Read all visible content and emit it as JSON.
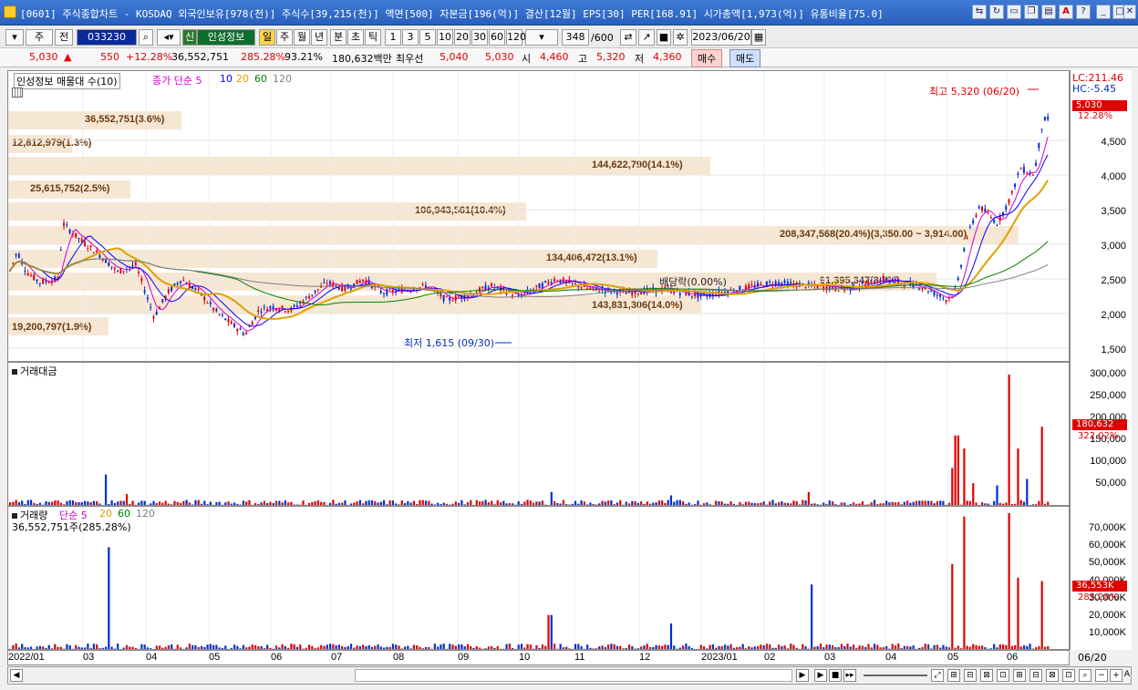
{
  "window": {
    "title": "[0601] 주식종합차트 - KOSDAQ 외국인보유[978(천)] 주식수[39,215(천)] 액면[500] 자본금[196(억)] 결산[12월] EPS[30] PER[168.91] 시가총액[1,973(억)] 유통비율[75.0]"
  },
  "toolbar": {
    "period_sel": "주",
    "prev": "전",
    "code": "033230",
    "name": "인성정보",
    "icon_shin": "신",
    "btn_il": "일",
    "btn_ju": "주",
    "btn_wol": "월",
    "btn_nyeon": "년",
    "btn_bun": "분",
    "btn_cho": "초",
    "btn_tik": "틱",
    "intervals": [
      "1",
      "3",
      "5",
      "10",
      "20",
      "30",
      "60",
      "120"
    ],
    "count": "348",
    "count_total": "/600",
    "date": "2023/06/20"
  },
  "info": {
    "price": "5,030",
    "change": "550",
    "change_pct": "+12.28%",
    "volume": "36,552,751",
    "vol_ratio": "285.28%",
    "strength": "93.21%",
    "amount": "180,632백만",
    "pref_label": "최우선",
    "ask": "5,040",
    "bid": "5,030",
    "open_label": "시",
    "open": "4,460",
    "high_label": "고",
    "high": "5,320",
    "low_label": "저",
    "low": "4,360",
    "buy": "매수",
    "sell": "매도"
  },
  "price_panel": {
    "legend_title": "인성정보 매물대 수(10)",
    "ma_label": "종가 단순 5",
    "ma": [
      "10",
      "20",
      "60",
      "120"
    ],
    "lc": "LC:211.46",
    "hc": "HC:-5.45",
    "max_label": "최고 5,320 (06/20)",
    "min_label": "최저 1,615 (09/30)",
    "dividend": "배당락(0.00%)",
    "cur_price": "5,030",
    "cur_pct": "12.28%",
    "y_ticks": [
      "4,500",
      "4,000",
      "3,500",
      "3,000",
      "2,500",
      "2,000",
      "1,500"
    ],
    "bands": [
      "36,552,751(3.6%)",
      "12,812,979(1.3%)",
      "144,622,790(14.1%)",
      "25,615,752(2.5%)",
      "106,943,561(10.4%)",
      "208,347,568(20.4%)(3,350.00 ~ 3,914.00)",
      "134,406,472(13.1%)",
      "91,395,347(8.7%)",
      "143,831,306(14.0%)",
      "19,200,797(1.9%)"
    ]
  },
  "amount_panel": {
    "title": "거래대금",
    "y_ticks": [
      "300,000",
      "250,000",
      "200,000",
      "150,000",
      "100,000",
      "50,000"
    ],
    "cur": "180,632",
    "cur_pct": "322.02%"
  },
  "volume_panel": {
    "title": "거래량",
    "ma_label": "단순 5",
    "ma": [
      "20",
      "60",
      "120"
    ],
    "sub": "36,552,751주(285.28%)",
    "y_ticks": [
      "70,000K",
      "60,000K",
      "50,000K",
      "40,000K",
      "30,000K",
      "20,000K",
      "10,000K"
    ],
    "cur": "36,553K",
    "cur_pct": "285.28%"
  },
  "xaxis": [
    "2022/01",
    "03",
    "04",
    "05",
    "06",
    "07",
    "08",
    "09",
    "10",
    "11",
    "12",
    "2023/01",
    "02",
    "03",
    "04",
    "05",
    "06"
  ],
  "xaxis_end": "06/20",
  "colors": {
    "up": "#e00000",
    "down": "#0030d0",
    "ma5": "#d000d0",
    "ma10": "#0000ff",
    "ma20": "#e0a000",
    "ma60": "#008000",
    "ma120": "#808080",
    "band": "#f6e7d4"
  }
}
